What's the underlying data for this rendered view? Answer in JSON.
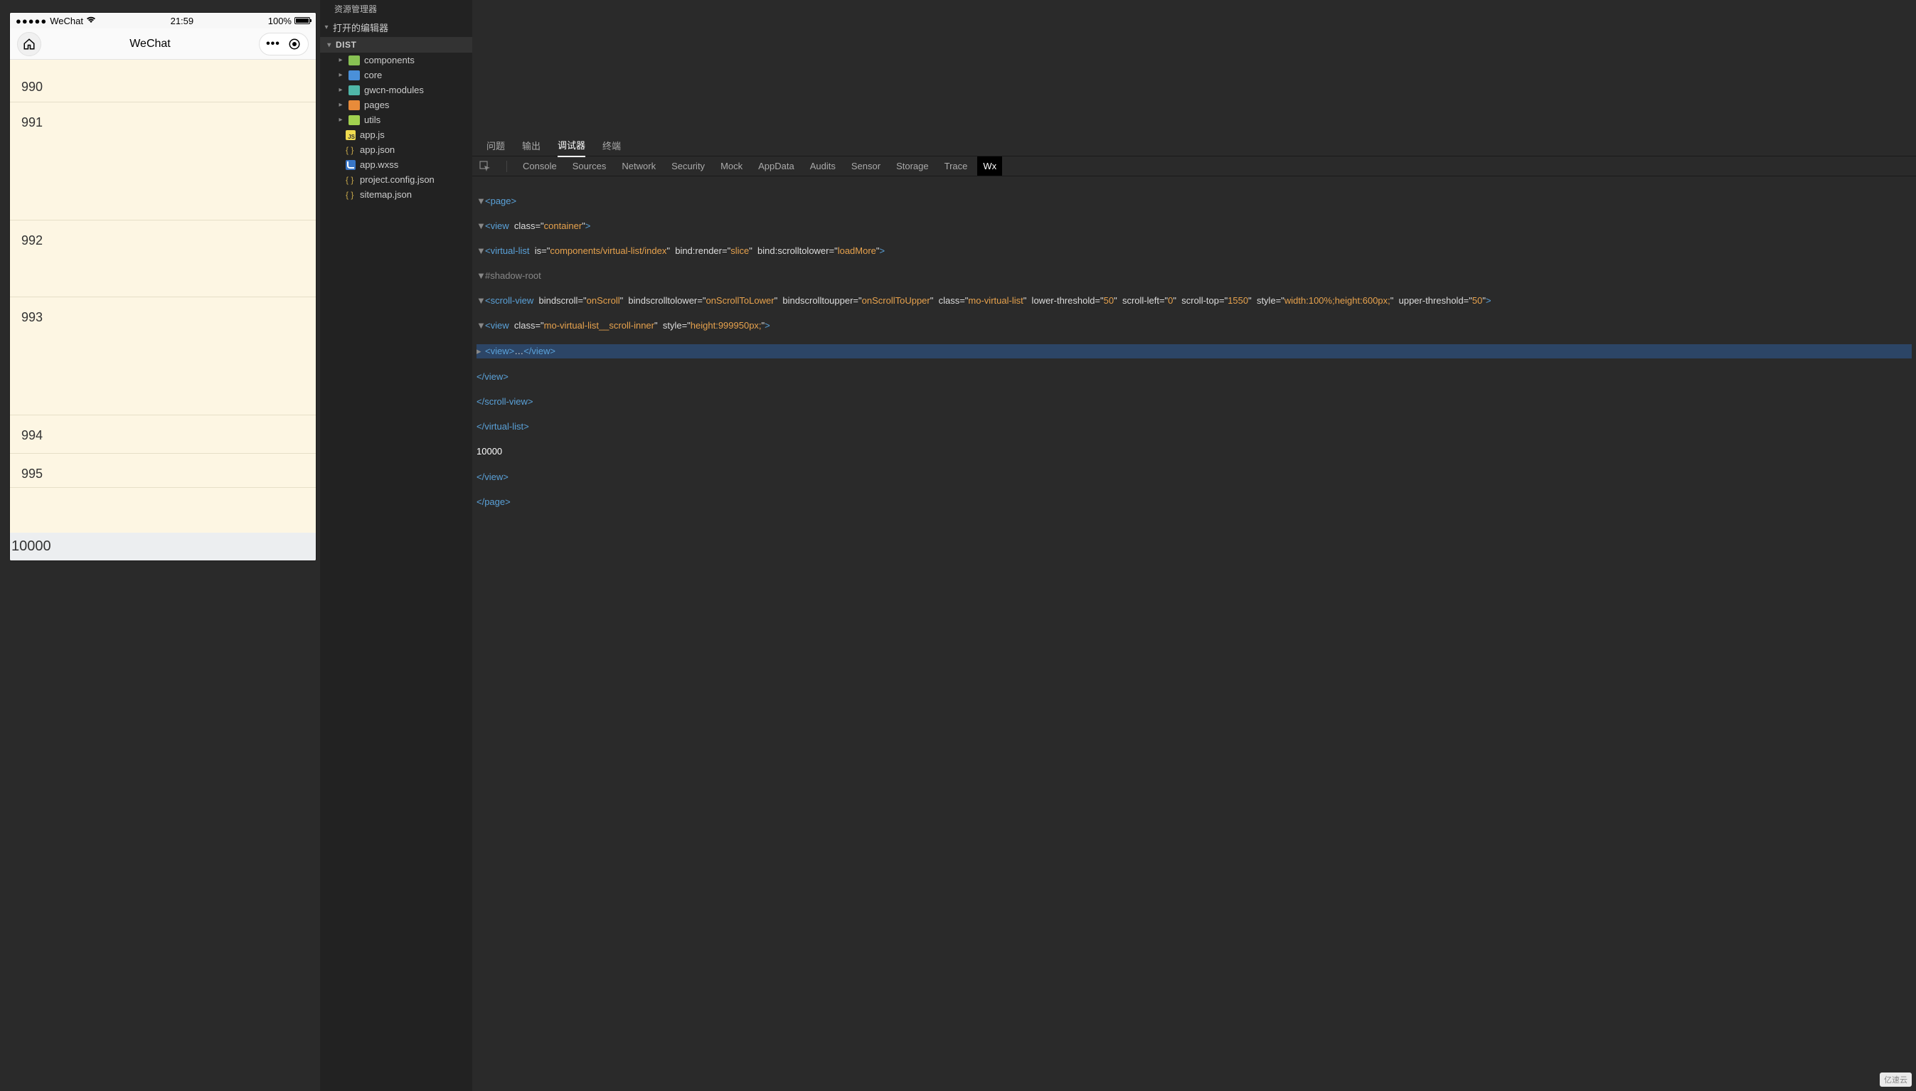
{
  "phone": {
    "status": {
      "carrier": "WeChat",
      "time": "21:59",
      "battery_pct": "100%"
    },
    "nav": {
      "title": "WeChat"
    },
    "rows": [
      "990",
      "991",
      "992",
      "993",
      "994",
      "995"
    ],
    "total": "10000"
  },
  "explorer": {
    "title": "资源管理器",
    "open_editors": "打开的编辑器",
    "root": "DIST",
    "folders": [
      "components",
      "core",
      "gwcn-modules",
      "pages",
      "utils"
    ],
    "files": [
      "app.js",
      "app.json",
      "app.wxss",
      "project.config.json",
      "sitemap.json"
    ]
  },
  "devtools": {
    "tabs1": [
      "问题",
      "输出",
      "调试器",
      "终端"
    ],
    "tabs1_active": "调试器",
    "tabs2": [
      "Console",
      "Sources",
      "Network",
      "Security",
      "Mock",
      "AppData",
      "Audits",
      "Sensor",
      "Storage",
      "Trace",
      "Wx"
    ],
    "tabs2_active": "Wx",
    "dom": {
      "page_open": "<page>",
      "view_container": "<view  class=\"container\">",
      "virtual_list_open": "<virtual-list  is=\"components/virtual-list/index\"  bind:render=\"slice\"  bind:scrolltolower=\"loadMore\">",
      "shadow": "#shadow-root",
      "scroll_view": "<scroll-view  bindscroll=\"onScroll\"  bindscrolltolower=\"onScrollToLower\"  bindscrolltoupper=\"onScrollToUpper\"  class=\"mo-virtual-list\"  lower-threshold=\"50\"  scroll-left=\"0\"  scroll-top=\"1550\"  style=\"width:100%;height:600px;\"  upper-threshold=\"50\">",
      "inner_view": "<view  class=\"mo-virtual-list__scroll-inner\"  style=\"height:999950px;\">",
      "collapsed_view": "<view>…</view>",
      "close_view": "</view>",
      "close_scroll": "</scroll-view>",
      "close_vlist": "</virtual-list>",
      "value_10000": "10000",
      "close_container": "</view>",
      "close_page": "</page>"
    }
  },
  "watermark": "亿速云"
}
